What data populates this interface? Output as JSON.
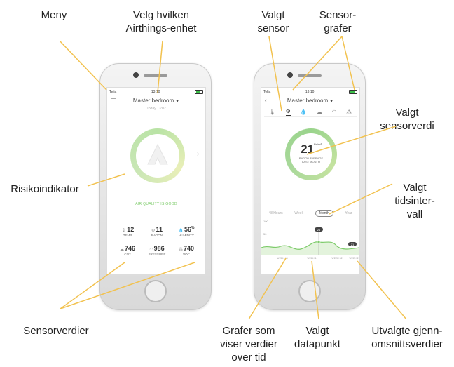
{
  "callouts": {
    "menu": "Meny",
    "choose_device": "Velg hvilken Airthings-enhet",
    "selected_sensor": "Valgt sensor",
    "sensor_graphs": "Sensor-grafer",
    "selected_value": "Valgt sensorverdi",
    "risk_indicator": "Risikoindikator",
    "selected_interval": "Valgt tidsinter-vall",
    "sensor_values": "Sensorverdier",
    "graphs_over_time": "Grafer som viser verdier over tid",
    "selected_datapoint": "Valgt datapunkt",
    "selected_averages": "Utvalgte gjenn-omsnittsverdier"
  },
  "left_phone": {
    "status": {
      "carrier": "Telia",
      "time": "13:10"
    },
    "menu_icon": "hamburger-icon",
    "device": "Master bedroom",
    "date": "Today 13:02",
    "quality": "AIR QUALITY IS GOOD",
    "sensors": [
      {
        "icon": "thermometer-icon",
        "value": "12",
        "unit": "",
        "label": "TEMP"
      },
      {
        "icon": "radon-icon",
        "value": "11",
        "unit": "",
        "label": "RADON"
      },
      {
        "icon": "humidity-icon",
        "value": "56",
        "unit": "%",
        "label": "HUMIDITY"
      },
      {
        "icon": "cloud-icon",
        "value": "746",
        "unit": "",
        "label": "CO2"
      },
      {
        "icon": "gauge-icon",
        "value": "986",
        "unit": "",
        "label": "PRESSURE"
      },
      {
        "icon": "voc-icon",
        "value": "740",
        "unit": "",
        "label": "VOC"
      }
    ]
  },
  "right_phone": {
    "status": {
      "carrier": "Telia",
      "time": "13:10"
    },
    "back_icon": "back-chevron-icon",
    "device": "Master bedroom",
    "tabs": [
      "thermometer-icon",
      "radon-icon",
      "humidity-icon",
      "cloud-icon",
      "gauge-icon",
      "voc-icon"
    ],
    "selected_tab": 1,
    "reading": {
      "value": "21",
      "unit": "Bq/m³",
      "line1": "RADON AVERAGE",
      "line2": "LAST MONTH"
    },
    "periods": [
      "48 Hours",
      "Week",
      "Month",
      "Year"
    ],
    "selected_period": "Month",
    "y_labels": [
      "100",
      "50"
    ],
    "x_labels": [
      "WEEK 48",
      "WEEK 1",
      "WEEK 52",
      "WEEK 2"
    ],
    "marker_value": "21",
    "end_value": "21"
  },
  "colors": {
    "ring_green": "#9ad48c",
    "ring_yellow": "#e9efb8",
    "callout_line": "#f2c24f",
    "good_text": "#7dcb6a"
  }
}
